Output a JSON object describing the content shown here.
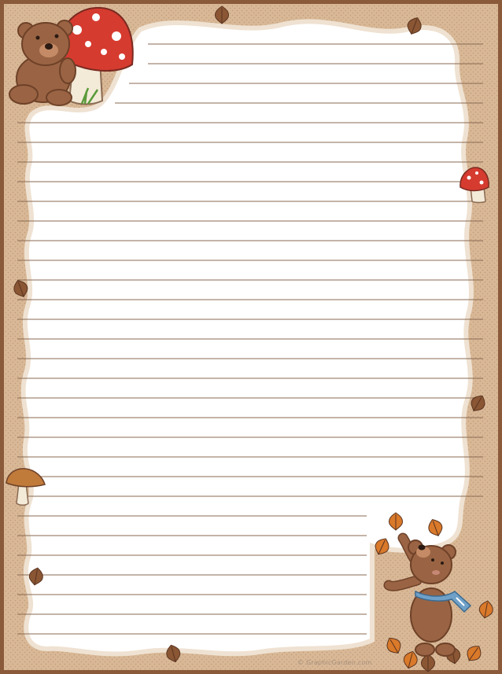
{
  "stationery": {
    "theme": "autumn teddy bears",
    "credit_text": "© GraphicGarden.com",
    "line_count": 31
  },
  "colors": {
    "outer_frame": "#8a5a3a",
    "border_fill": "#d8b896",
    "border_dots": "#c39a78",
    "paper": "#ffffff",
    "rule_lines": "#8a6a52",
    "bear_fur": "#9a6444",
    "bear_dark": "#6e4128",
    "mushroom_cap": "#d63b2f",
    "mushroom_stem": "#f3ead8",
    "scarf": "#6fa0c8",
    "leaf_orange": "#d9792a",
    "leaf_brown": "#8a5634"
  },
  "icons": [
    "teddy-bear-icon",
    "red-mushroom-icon",
    "brown-mushroom-icon",
    "autumn-leaf-icon",
    "bear-with-scarf-icon"
  ]
}
